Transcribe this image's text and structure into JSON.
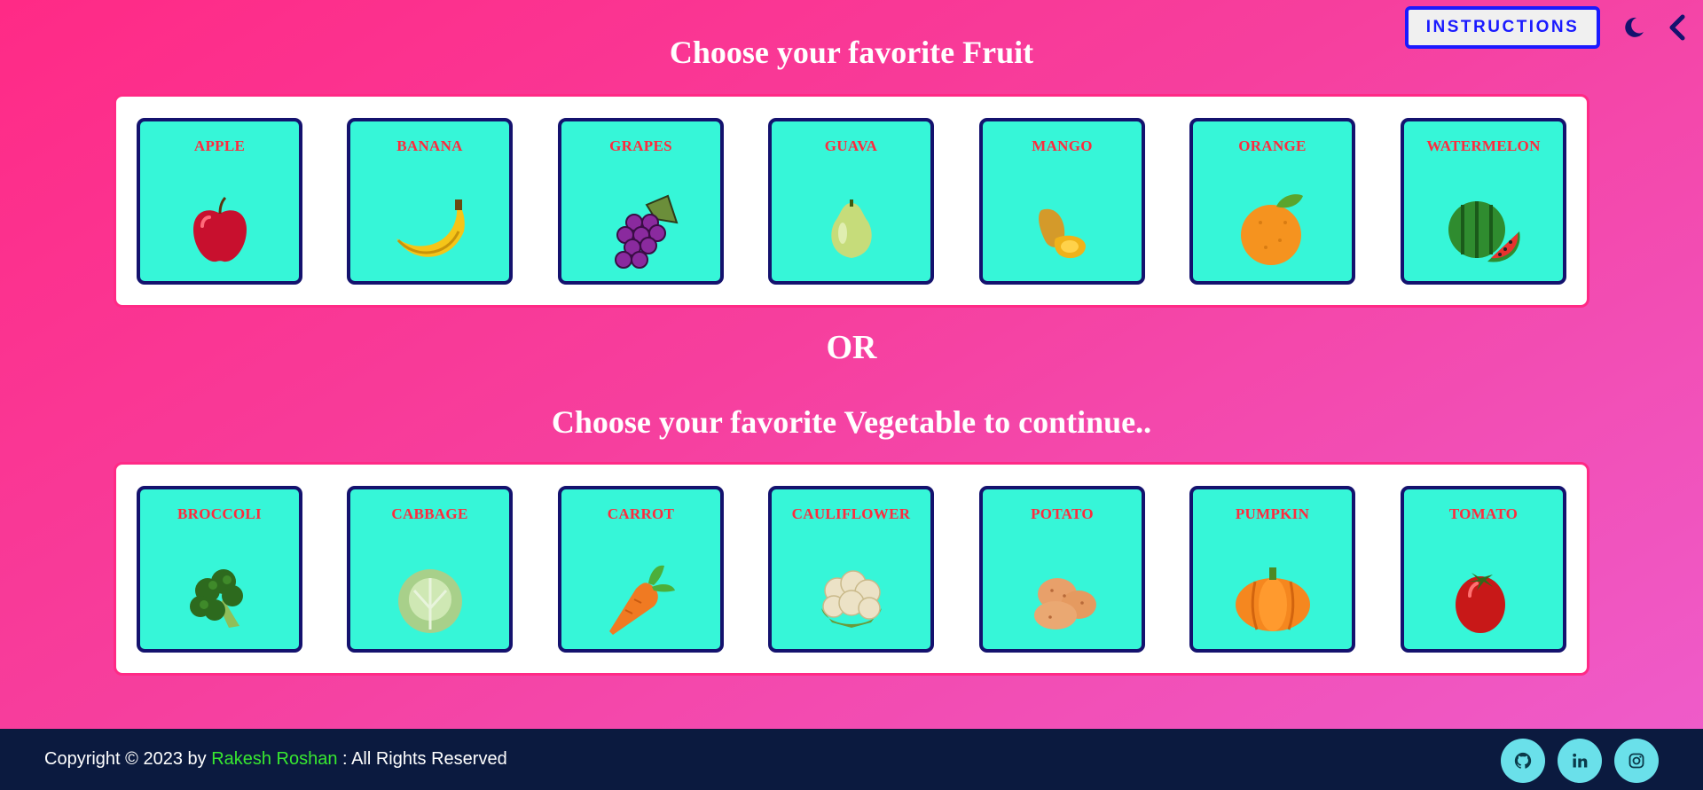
{
  "header": {
    "instructions_label": "INSTRUCTIONS",
    "theme_icon": "moon-icon",
    "back_icon": "chevron-left-icon"
  },
  "fruits": {
    "heading": "Choose your favorite Fruit",
    "items": [
      {
        "label": "APPLE",
        "icon": "apple-icon"
      },
      {
        "label": "BANANA",
        "icon": "banana-icon"
      },
      {
        "label": "GRAPES",
        "icon": "grapes-icon"
      },
      {
        "label": "GUAVA",
        "icon": "guava-icon"
      },
      {
        "label": "MANGO",
        "icon": "mango-icon"
      },
      {
        "label": "ORANGE",
        "icon": "orange-icon"
      },
      {
        "label": "WATERMELON",
        "icon": "watermelon-icon"
      }
    ]
  },
  "divider_text": "OR",
  "vegetables": {
    "heading": "Choose your favorite Vegetable to continue..",
    "items": [
      {
        "label": "BROCCOLI",
        "icon": "broccoli-icon"
      },
      {
        "label": "CABBAGE",
        "icon": "cabbage-icon"
      },
      {
        "label": "CARROT",
        "icon": "carrot-icon"
      },
      {
        "label": "CAULIFLOWER",
        "icon": "cauliflower-icon"
      },
      {
        "label": "POTATO",
        "icon": "potato-icon"
      },
      {
        "label": "PUMPKIN",
        "icon": "pumpkin-icon"
      },
      {
        "label": "TOMATO",
        "icon": "tomato-icon"
      }
    ]
  },
  "footer": {
    "copyright_prefix": "Copyright © 2023 by ",
    "author": "Rakesh Roshan",
    "copyright_suffix": " : All Rights Reserved",
    "socials": [
      "github-icon",
      "linkedin-icon",
      "instagram-icon"
    ]
  },
  "colors": {
    "card_bg": "#36f6d8",
    "card_border": "#14126e",
    "card_label": "#ff2a3d",
    "footer_bg": "#0b1a3f",
    "author": "#38e830",
    "social_bg": "#6ae0ea"
  }
}
